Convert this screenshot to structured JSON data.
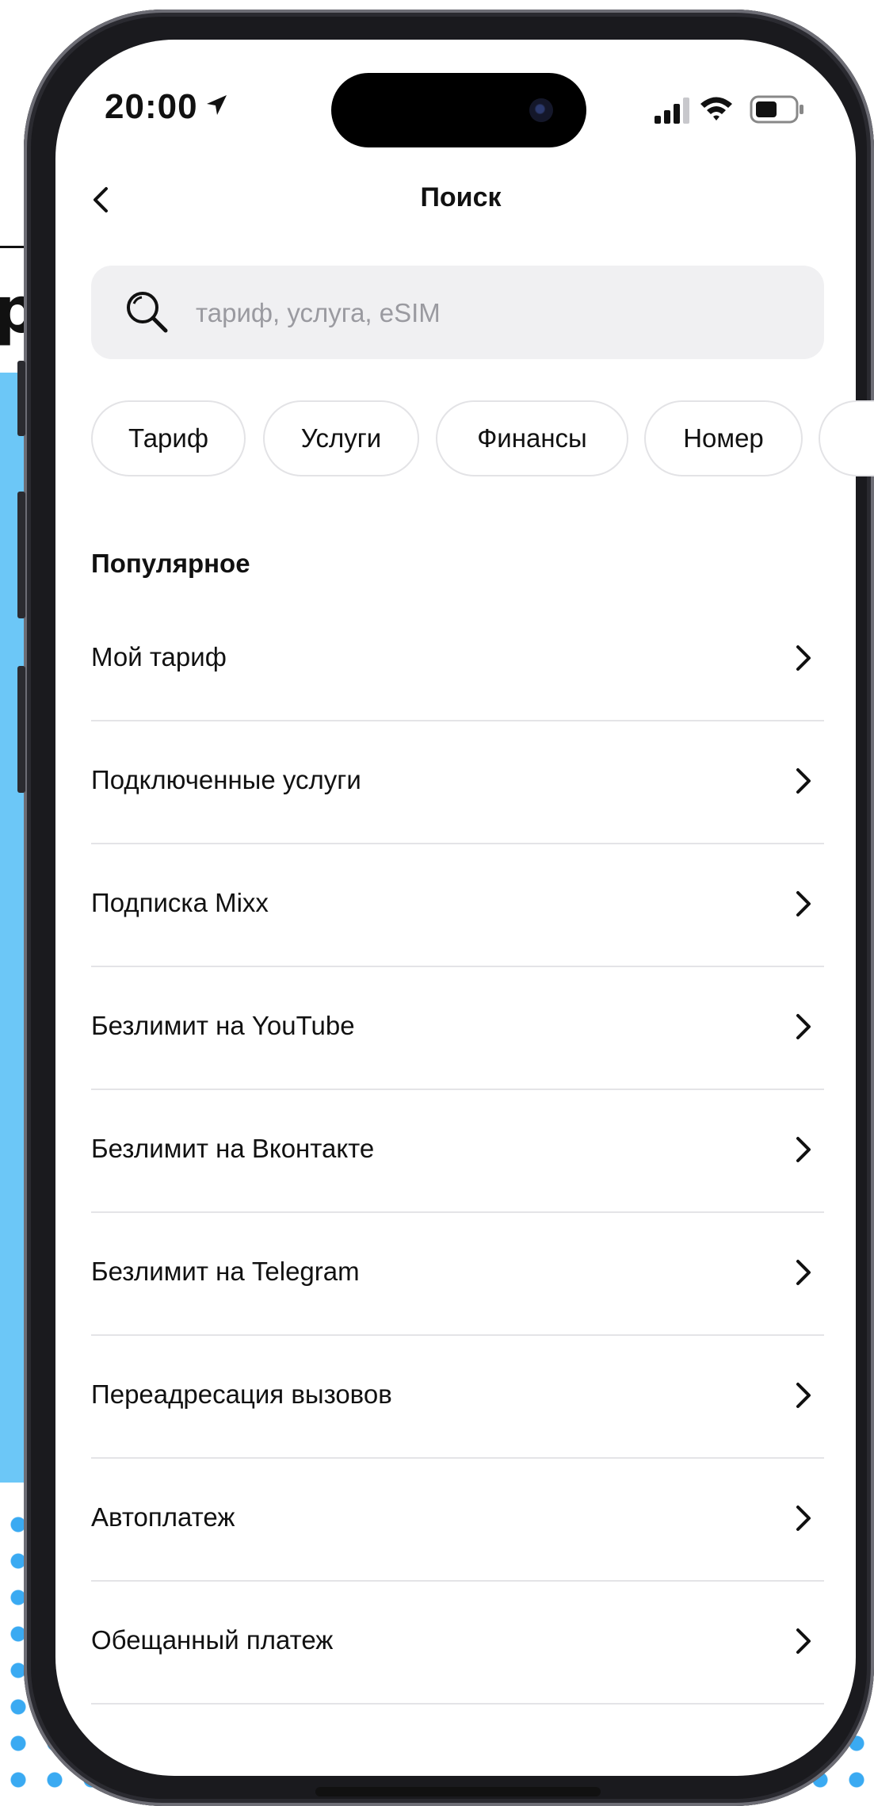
{
  "status_bar": {
    "time": "20:00"
  },
  "nav": {
    "title": "Поиск"
  },
  "search": {
    "placeholder": "тариф, услуга, eSIM"
  },
  "chips": [
    "Тариф",
    "Услуги",
    "Финансы",
    "Номер"
  ],
  "section": {
    "title": "Популярное"
  },
  "items": [
    "Мой тариф",
    "Подключенные услуги",
    "Подписка Mixx",
    "Безлимит на YouTube",
    "Безлимит на Вконтакте",
    "Безлимит на Telegram",
    "Переадресация вызовов",
    "Автоплатеж",
    "Обещанный платеж"
  ],
  "background": {
    "heading_fragment": "р"
  },
  "colors": {
    "accent_background": "#6cc7f7",
    "dots": "#3aaaf2",
    "chip_border": "#e3e3e6",
    "search_bg": "#f0f0f2"
  }
}
